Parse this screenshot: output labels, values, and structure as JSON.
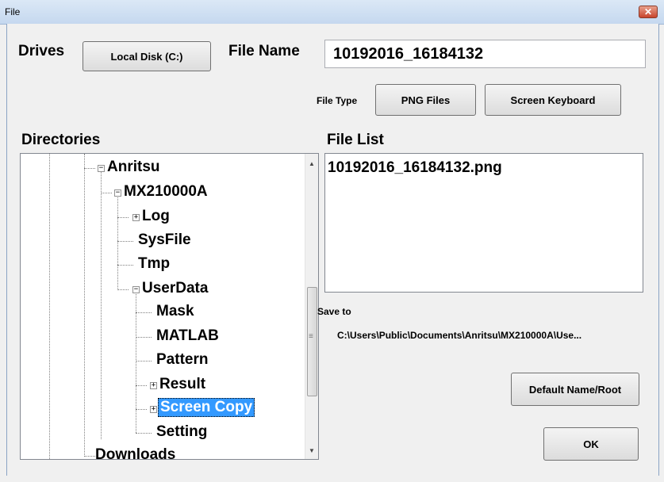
{
  "window": {
    "title": "File",
    "close_glyph": "✕"
  },
  "drives": {
    "label": "Drives",
    "button": "Local Disk (C:)"
  },
  "file_name": {
    "label": "File Name",
    "value": "10192016_16184132"
  },
  "file_type": {
    "label": "File Type",
    "button": "PNG Files"
  },
  "screen_keyboard_button": "Screen Keyboard",
  "directories": {
    "label": "Directories",
    "nodes": [
      "Anritsu",
      "MX210000A",
      "Log",
      "SysFile",
      "Tmp",
      "UserData",
      "Mask",
      "MATLAB",
      "Pattern",
      "Result",
      "Screen Copy",
      "Setting",
      "Downloads"
    ],
    "selected": "Screen Copy"
  },
  "file_list": {
    "label": "File List",
    "items": [
      "10192016_16184132.png"
    ]
  },
  "save_to": {
    "label": "Save to",
    "path": "C:\\Users\\Public\\Documents\\Anritsu\\MX210000A\\Use..."
  },
  "buttons": {
    "default_name_root": "Default Name/Root",
    "ok": "OK"
  }
}
